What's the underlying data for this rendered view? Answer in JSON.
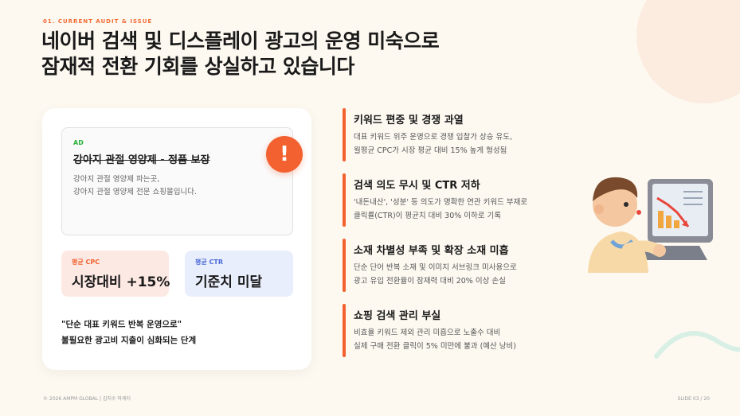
{
  "section_label": "01. CURRENT AUDIT & ISSUE",
  "title_line1": "네이버 검색 및 디스플레이 광고의 운영 미숙으로",
  "title_line2": "잠재적 전환 기회를 상실하고 있습니다",
  "ad_example": {
    "tag": "AD",
    "title": "강아지 관절 영양제 - 정품 보장",
    "desc_line1": "강아지 관절 영양제 파는곳,",
    "desc_line2": "강아지 관절 영양제 전문 쇼핑몰입니다.",
    "alert_symbol": "!"
  },
  "stats": {
    "cpc_label": "평균 CPC",
    "cpc_value": "시장대비 +15%",
    "ctr_label": "평균 CTR",
    "ctr_value": "기준치 미달"
  },
  "quote_line1": "\"단순 대표 키워드 반복 운영으로\"",
  "quote_line2": "불필요한 광고비 지출이 심화되는 단계",
  "issues": [
    {
      "title": "키워드 편중 및 경쟁 과열",
      "desc1": "대표 키워드 위주 운영으로 경쟁 입찰가 상승 유도,",
      "desc2": "월평균 CPC가 시장 평균 대비 15% 높게 형성됨"
    },
    {
      "title": "검색 의도 무시 및 CTR 저하",
      "desc1": "'내돈내산', '성분' 등 의도가 명확한 연관 키워드 부재로",
      "desc2": "클릭률(CTR)이 평균치 대비 30% 이하로 기록"
    },
    {
      "title": "소재 차별성 부족 및 확장 소재 미흡",
      "desc1": "단순 단어 반복 소재 및 이미지 서브링크 미사용으로",
      "desc2": "광고 유입 전환율이 잠재력 대비 20% 이상 손실"
    },
    {
      "title": "쇼핑 검색 관리 부실",
      "desc1": "비효율 키워드 제외 관리 미흡으로 노출수 대비",
      "desc2": "실제 구매 전환 클릭이 5% 미만에 불과 (예산 낭비)"
    }
  ],
  "footer_left": "© 2026 AMPM GLOBAL | 김지수 마케터",
  "footer_right": "SLIDE 03 / 20",
  "colors": {
    "accent": "#f2612f",
    "background": "#fdf9f1",
    "ad_green": "#2db33d",
    "ctr_blue": "#4a6ad8"
  }
}
